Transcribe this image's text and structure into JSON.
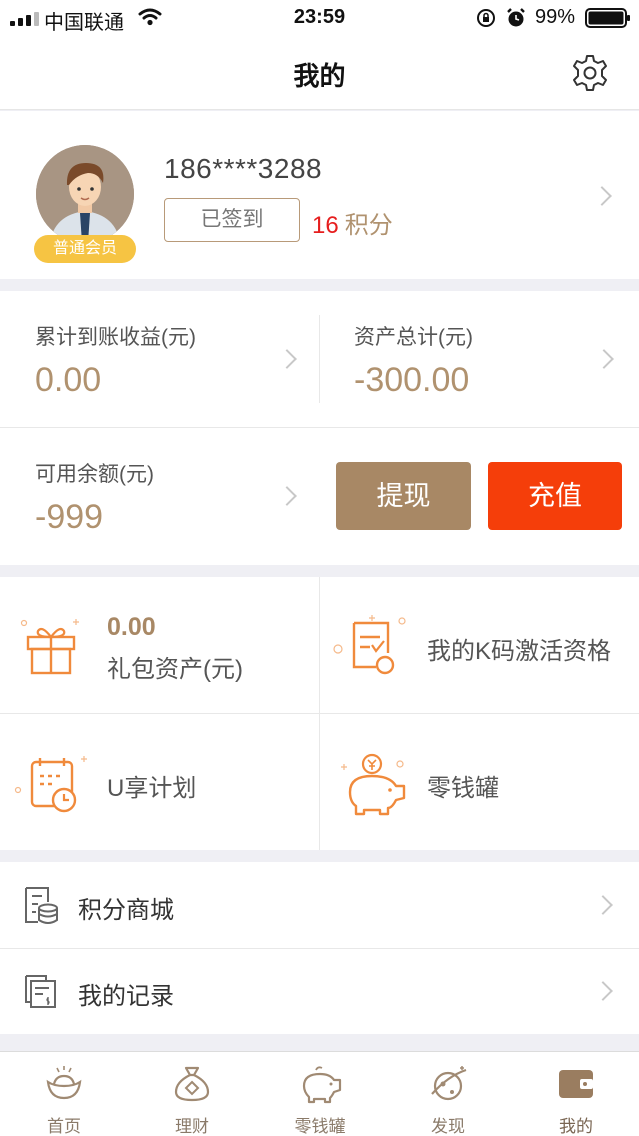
{
  "status_bar": {
    "carrier": "中国联通",
    "time": "23:59",
    "battery": "99%"
  },
  "nav": {
    "title": "我的"
  },
  "profile": {
    "phone": "186****3288",
    "member_level": "普通会员",
    "signin_label": "已签到",
    "points_value": "16",
    "points_unit": "积分"
  },
  "assets": {
    "cumulative_income_label": "累计到账收益(元)",
    "cumulative_income_value": "0.00",
    "total_assets_label": "资产总计(元)",
    "total_assets_value": "-300.00",
    "available_balance_label": "可用余额(元)",
    "available_balance_value": "-999",
    "withdraw_label": "提现",
    "recharge_label": "充值"
  },
  "grid": {
    "gift_value": "0.00",
    "gift_label": "礼包资产(元)",
    "kcode_label": "我的K码激活资格",
    "u_plan_label": "U享计划",
    "piggy_label": "零钱罐"
  },
  "list": {
    "items": [
      {
        "label": "积分商城",
        "icon": "coins-list-icon"
      },
      {
        "label": "我的记录",
        "icon": "records-icon"
      }
    ]
  },
  "tabbar": {
    "tabs": [
      {
        "label": "首页",
        "icon": "ingot-icon"
      },
      {
        "label": "理财",
        "icon": "money-bag-icon"
      },
      {
        "label": "零钱罐",
        "icon": "piggy-bank-icon"
      },
      {
        "label": "发现",
        "icon": "planet-icon"
      },
      {
        "label": "我的",
        "icon": "wallet-icon"
      }
    ],
    "active_index": 4
  },
  "colors": {
    "accent_gold": "#b0926f",
    "withdraw_bg": "#a88865",
    "recharge_bg": "#f53e0a",
    "badge_yellow": "#f6c443",
    "points_red": "#e61e1e",
    "icon_orange": "#f5a05a"
  }
}
